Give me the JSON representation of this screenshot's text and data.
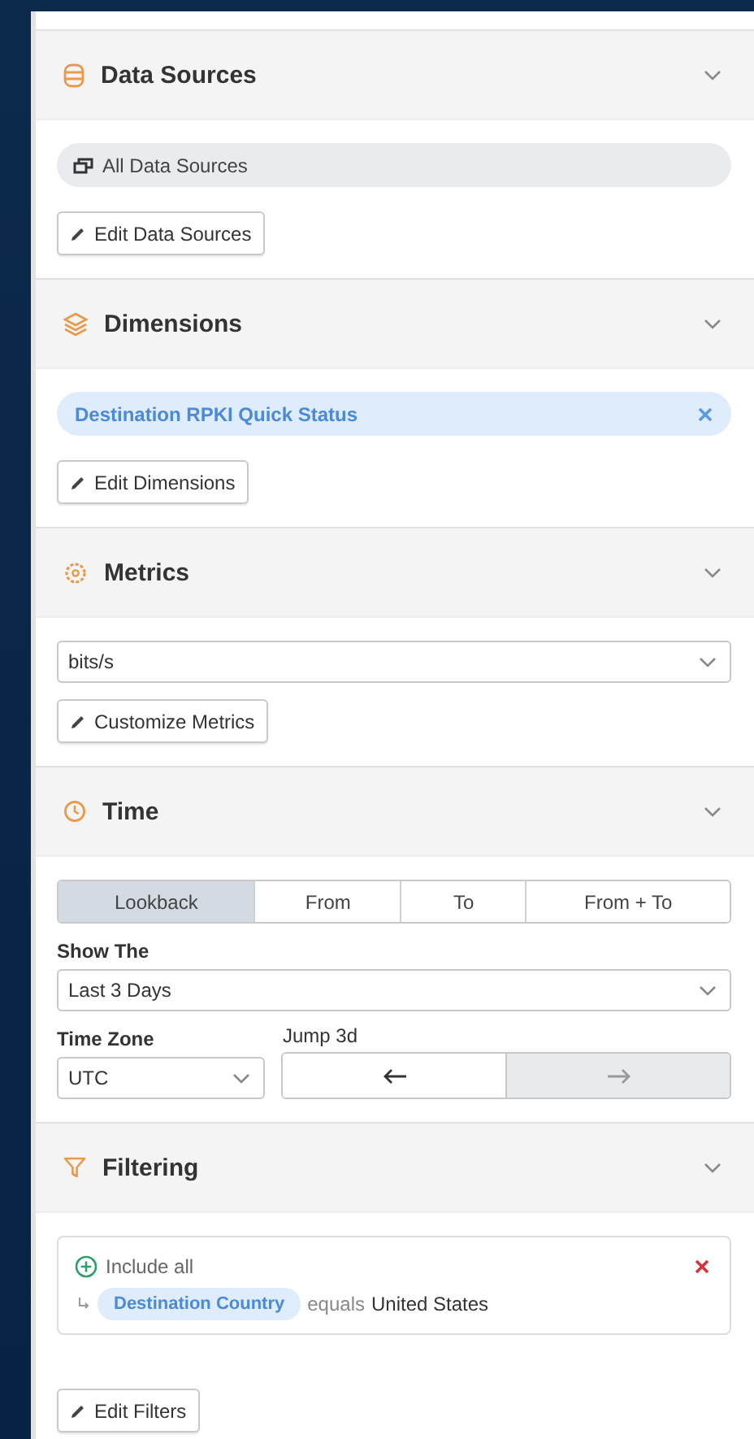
{
  "sections": [
    {
      "kind": "data_sources",
      "title": "Data Sources",
      "chip": "All Data Sources",
      "button": "Edit Data Sources"
    },
    {
      "kind": "dimensions",
      "title": "Dimensions",
      "tags": [
        "Destination RPKI Quick Status"
      ],
      "button": "Edit Dimensions"
    },
    {
      "kind": "metrics",
      "title": "Metrics",
      "select": "bits/s",
      "button": "Customize Metrics"
    },
    {
      "kind": "time",
      "title": "Time",
      "modes": [
        {
          "label": "Lookback",
          "selected": true
        },
        {
          "label": "From",
          "selected": false
        },
        {
          "label": "To",
          "selected": false
        },
        {
          "label": "From + To",
          "selected": false
        }
      ],
      "show_label": "Show The",
      "show_value": "Last 3 Days",
      "zone_label": "Time Zone",
      "zone_value": "UTC",
      "jump_label": "Jump 3d",
      "jump_buttons": [
        {
          "kind": "back",
          "disabled": false
        },
        {
          "kind": "forward",
          "disabled": true
        }
      ]
    },
    {
      "kind": "filtering",
      "title": "Filtering",
      "group": "Include all",
      "filters": [
        {
          "field": "Destination Country",
          "operator": "equals",
          "value": "United States"
        }
      ],
      "button": "Edit Filters"
    }
  ]
}
